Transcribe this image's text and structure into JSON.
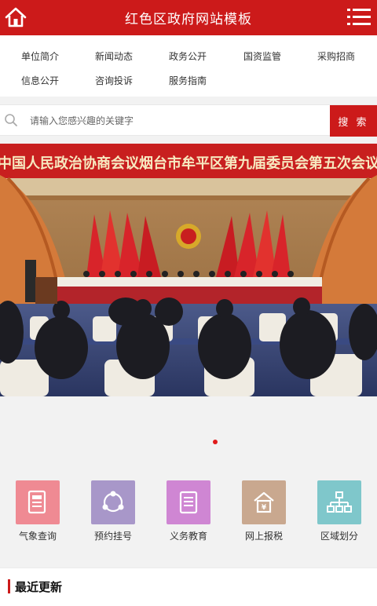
{
  "header": {
    "title": "红色区政府网站模板",
    "home_icon": "home-icon",
    "menu_icon": "menu-icon"
  },
  "nav": {
    "items": [
      {
        "label": "单位简介"
      },
      {
        "label": "新闻动态"
      },
      {
        "label": "政务公开"
      },
      {
        "label": "国资监管"
      },
      {
        "label": "采购招商"
      },
      {
        "label": "信息公开"
      },
      {
        "label": "咨询投诉"
      },
      {
        "label": "服务指南"
      }
    ]
  },
  "search": {
    "placeholder": "请输入您感兴趣的关键字",
    "button": "搜 索"
  },
  "banner": {
    "headline": "中国人民政治协商会议烟台市牟平区第九届委员会第五次会议"
  },
  "quick": {
    "items": [
      {
        "label": "气象查询",
        "icon": "document-icon",
        "color": "#ef8a93"
      },
      {
        "label": "预约挂号",
        "icon": "network-icon",
        "color": "#a897c9"
      },
      {
        "label": "义务教育",
        "icon": "book-icon",
        "color": "#cf86d3"
      },
      {
        "label": "网上报税",
        "icon": "tax-house-icon",
        "color": "#c9a88f"
      },
      {
        "label": "区域划分",
        "icon": "org-chart-icon",
        "color": "#7fc7cb"
      }
    ]
  },
  "latest": {
    "title": "最近更新"
  },
  "colors": {
    "brand": "#cc1a1a",
    "page_bg": "#f2f2f2"
  }
}
